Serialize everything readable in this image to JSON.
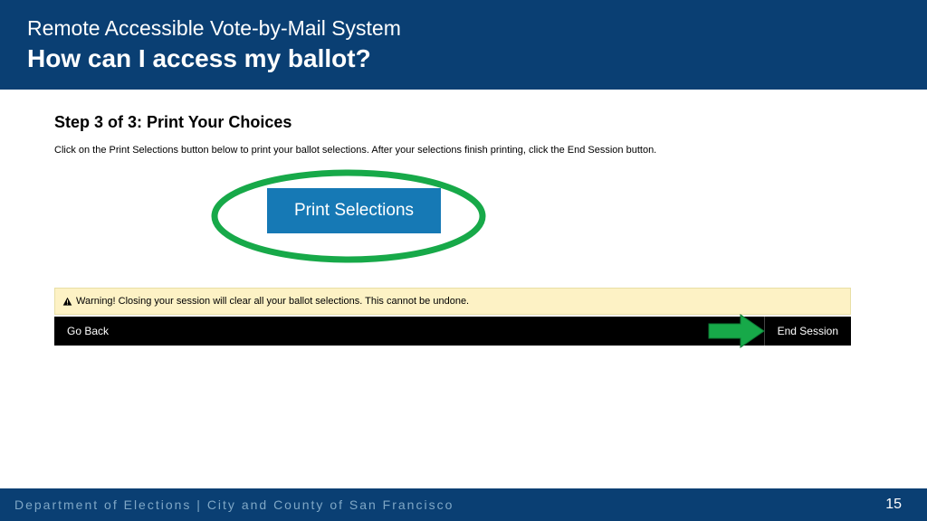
{
  "header": {
    "subtitle": "Remote Accessible Vote-by-Mail System",
    "title": "How can I access my ballot?"
  },
  "content": {
    "step_heading": "Step 3 of 3: Print Your Choices",
    "instruction": "Click on the Print Selections button below to print your ballot selections. After your selections finish printing, click the End Session button.",
    "print_button": "Print Selections",
    "warning": "Warning! Closing your session will clear all your ballot selections. This cannot be undone.",
    "go_back": "Go Back",
    "end_session": "End Session"
  },
  "footer": {
    "dept": "Department of Elections | City and County of San Francisco",
    "page": "15"
  }
}
